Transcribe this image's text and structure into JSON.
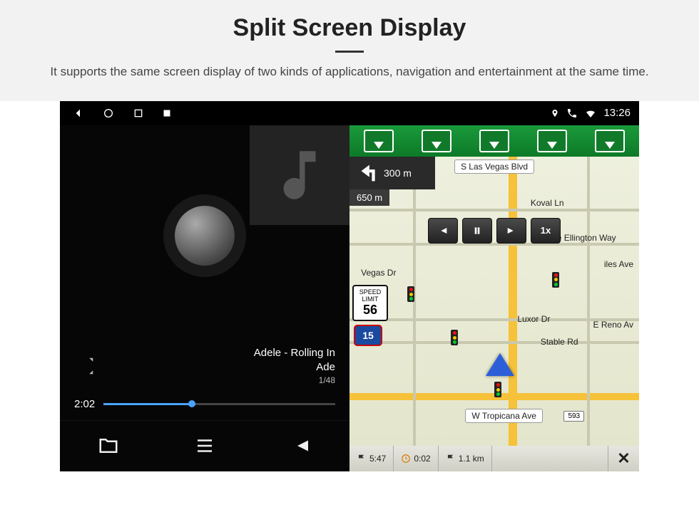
{
  "header": {
    "title": "Split Screen Display",
    "subtitle": "It supports the same screen display of two kinds of applications, navigation and entertainment at the same time."
  },
  "statusbar": {
    "time": "13:26"
  },
  "music": {
    "track": "Adele - Rolling In",
    "artist": "Ade",
    "index": "1/48",
    "elapsed": "2:02",
    "buttons": {
      "folder": "Folder",
      "list": "Playlist",
      "prev": "Previous"
    }
  },
  "navigation": {
    "lanes": 5,
    "turn_distance": "300 m",
    "next_distance": "650 m",
    "controls": {
      "speed_label": "1x"
    },
    "speed_limit": {
      "label": "SPEED LIMIT",
      "value": "56"
    },
    "route_shield": "15",
    "streets": {
      "top": "S Las Vegas Blvd",
      "koval": "Koval Ln",
      "duke": "Duke Ellington Way",
      "lasvegas2": "S Las Vegas Blvd",
      "vegas_dr": "Vegas Dr",
      "luxor": "Luxor Dr",
      "stable": "Stable Rd",
      "reno": "E Reno Av",
      "bottom": "W Tropicana Ave",
      "bottom_badge": "593",
      "iles": "iles Ave"
    },
    "footer": {
      "eta": "5:47",
      "time_remaining": "0:02",
      "distance": "1.1 km"
    }
  }
}
